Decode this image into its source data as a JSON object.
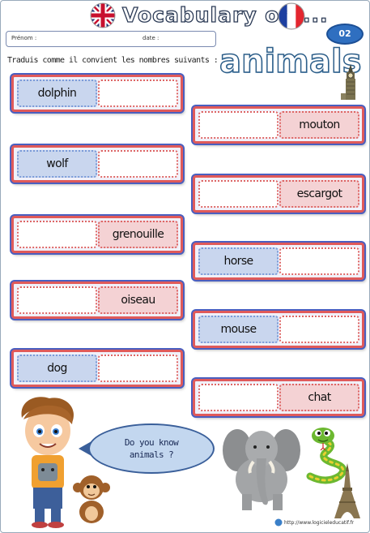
{
  "header": {
    "title": "Vocabulary on ...",
    "prenom_label": "Prénom :",
    "date_label": "date :",
    "sheet_number": "02"
  },
  "instruction": "Traduis comme il convient les nombres suivants :",
  "topic_title": "animals",
  "left_cards": [
    {
      "english": "dolphin",
      "french": ""
    },
    {
      "english": "wolf",
      "french": ""
    },
    {
      "english": "",
      "french": "grenouille"
    },
    {
      "english": "",
      "french": "oiseau"
    },
    {
      "english": "dog",
      "french": ""
    }
  ],
  "right_cards": [
    {
      "english": "",
      "french": "mouton"
    },
    {
      "english": "",
      "french": "escargot"
    },
    {
      "english": "horse",
      "french": ""
    },
    {
      "english": "mouse",
      "french": ""
    },
    {
      "english": "",
      "french": "chat"
    }
  ],
  "bubble": {
    "line1": "Do you know",
    "line2": "animals ?"
  },
  "footer": {
    "url": "http://www.logicieleducatif.fr"
  },
  "colors": {
    "card_border": "#e05a5a",
    "card_outer": "#4a5fc0",
    "english_cell": "#c9d6ee",
    "french_cell": "#f4d2d4",
    "badge": "#2f6fc0"
  }
}
